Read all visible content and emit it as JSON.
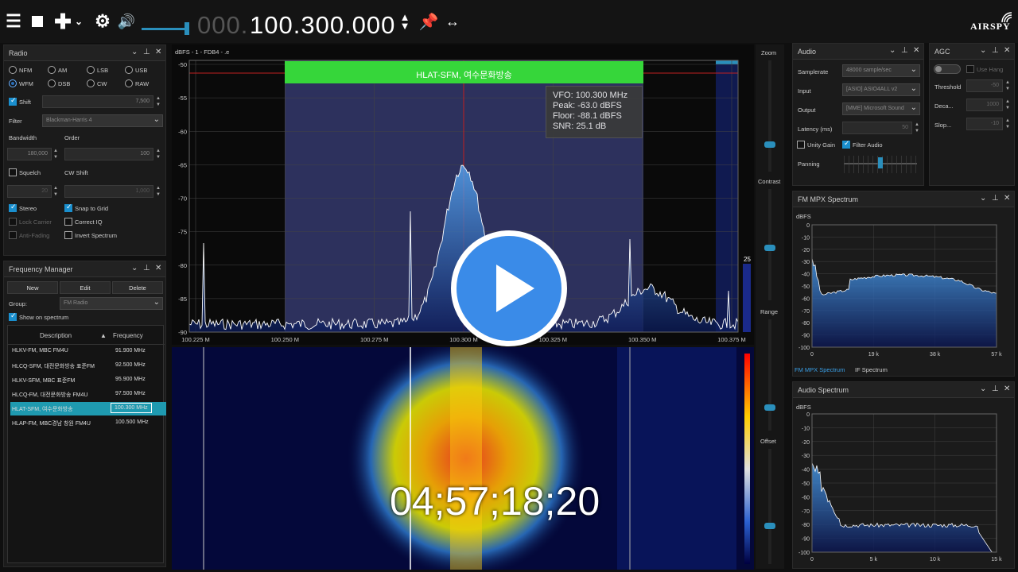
{
  "toolbar": {
    "freq_prefix": "000.",
    "freq": "100.300.000",
    "logo": "AIRSPY"
  },
  "radio": {
    "title": "Radio",
    "modes": [
      "NFM",
      "AM",
      "LSB",
      "USB",
      "WFM",
      "DSB",
      "CW",
      "RAW"
    ],
    "selected_mode": "WFM",
    "shift_label": "Shift",
    "shift_value": "7,500",
    "filter_label": "Filter",
    "filter_value": "Blackman-Harris 4",
    "bandwidth_label": "Bandwidth",
    "order_label": "Order",
    "bandwidth_value": "180,000",
    "order_value": "100",
    "squelch_label": "Squelch",
    "cwshift_label": "CW Shift",
    "squelch_value": "20",
    "cwshift_value": "1,000",
    "stereo_label": "Stereo",
    "snap_label": "Snap to Grid",
    "lock_label": "Lock Carrier",
    "correctiq_label": "Correct IQ",
    "antifade_label": "Anti-Fading",
    "invert_label": "Invert Spectrum"
  },
  "freqmgr": {
    "title": "Frequency Manager",
    "new_label": "New",
    "edit_label": "Edit",
    "delete_label": "Delete",
    "group_label": "Group:",
    "group_value": "FM Radio",
    "show_label": "Show on spectrum",
    "col_desc": "Description",
    "col_freq": "Frequency",
    "rows": [
      {
        "desc": "HLKV-FM, MBC FM4U",
        "freq": "91.900 MHz"
      },
      {
        "desc": "HLCQ-SFM, 대전문화방송 표준FM",
        "freq": "92.500 MHz"
      },
      {
        "desc": "HLKV-SFM, MBC 표준FM",
        "freq": "95.900 MHz"
      },
      {
        "desc": "HLCQ-FM, 대전문화방송 FM4U",
        "freq": "97.500 MHz"
      },
      {
        "desc": "HLAT-SFM, 여수문화방송",
        "freq": "100.300 MHz"
      },
      {
        "desc": "HLAP-FM, MBC경남 창원 FM4U",
        "freq": "100.500 MHz"
      }
    ],
    "selected_row": 4
  },
  "spectrum": {
    "header": "dBFS   -   1   -  FDB4  -                    .e",
    "band_label": "HLAT-SFM, 여수문화방송",
    "y_ticks": [
      "-50",
      "-55",
      "-60",
      "-65",
      "-70",
      "-75",
      "-80",
      "-85",
      "-90"
    ],
    "x_ticks": [
      "100.225 M",
      "100.250 M",
      "100.275 M",
      "100.300 M",
      "100.325 M",
      "100.350 M",
      "100.375 M"
    ],
    "tooltip": {
      "vfo": "VFO:  100.300 MHz",
      "peak": "Peak:  -63.0 dBFS",
      "floor": "Floor:  -88.1 dBFS",
      "snr": "SNR:  25.1 dB"
    },
    "side_value": "25"
  },
  "sidebar": {
    "zoom": "Zoom",
    "contrast": "Contrast",
    "range": "Range",
    "offset": "Offset"
  },
  "timecode": "04;57;18;20",
  "audio": {
    "title": "Audio",
    "samplerate_label": "Samplerate",
    "samplerate_value": "48000 sample/sec",
    "input_label": "Input",
    "input_value": "[ASIO] ASIO4ALL v2",
    "output_label": "Output",
    "output_value": "[MME] Microsoft Sound",
    "latency_label": "Latency (ms)",
    "latency_value": "50",
    "unity_label": "Unity Gain",
    "filteraudio_label": "Filter Audio",
    "panning_label": "Panning"
  },
  "agc": {
    "title": "AGC",
    "usehang_label": "Use Hang",
    "threshold_label": "Threshold",
    "threshold_value": "-50",
    "decay_label": "Deca...",
    "decay_value": "1000",
    "slope_label": "Slop...",
    "slope_value": "-10"
  },
  "mpx": {
    "title": "FM MPX Spectrum",
    "ylabel": "dBFS",
    "y_ticks": [
      "0",
      "-10",
      "-20",
      "-30",
      "-40",
      "-50",
      "-60",
      "-70",
      "-80",
      "-90",
      "-100"
    ],
    "x_ticks": [
      "0",
      "19 k",
      "38 k",
      "57 k"
    ],
    "tab1": "FM MPX Spectrum",
    "tab2": "IF Spectrum"
  },
  "audiospec": {
    "title": "Audio Spectrum",
    "ylabel": "dBFS",
    "y_ticks": [
      "0",
      "-10",
      "-20",
      "-30",
      "-40",
      "-50",
      "-60",
      "-70",
      "-80",
      "-90",
      "-100"
    ],
    "x_ticks": [
      "0",
      "5 k",
      "10 k",
      "15 k"
    ]
  }
}
